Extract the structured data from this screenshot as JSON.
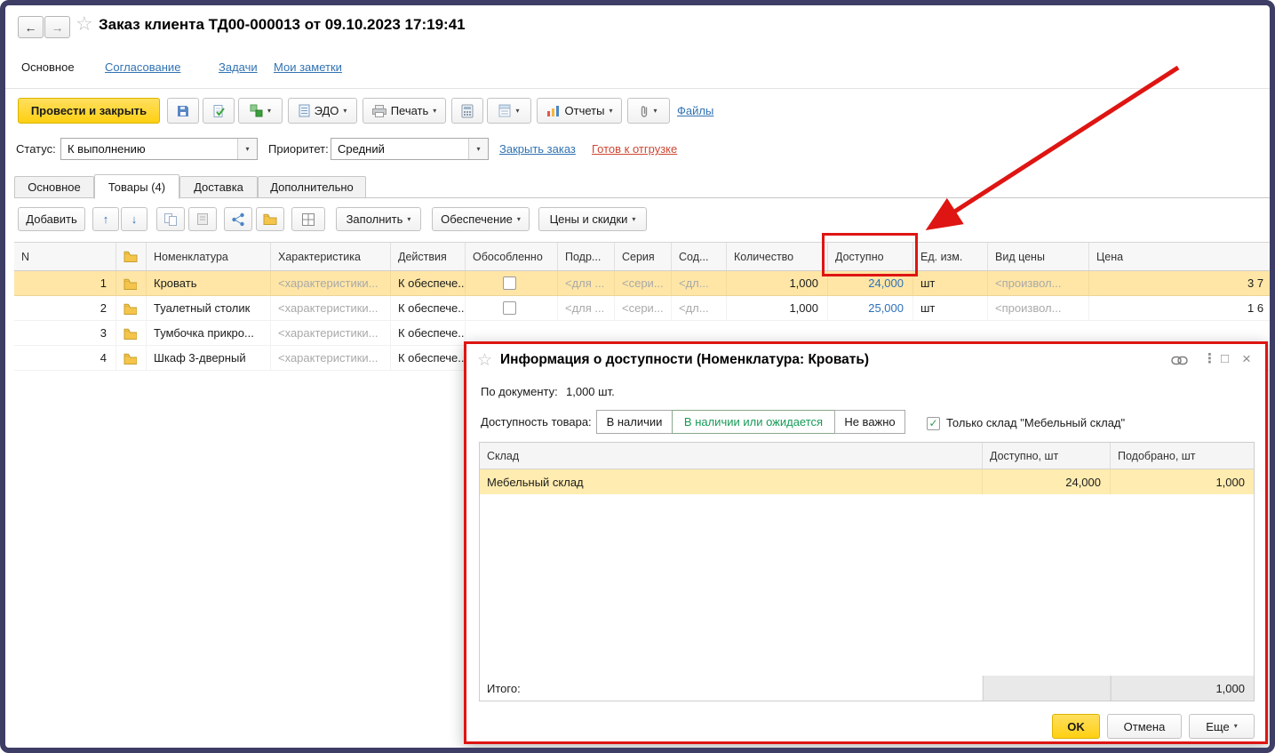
{
  "icons": {
    "back": "←",
    "forward": "→",
    "star": "☆",
    "dropdown": "▾",
    "combo": "▼",
    "up": "↑",
    "down": "↓",
    "check": "✓",
    "menu_dots": "⋮",
    "maximize": "□",
    "close": "×"
  },
  "header": {
    "title": "Заказ клиента ТД00-000013 от 09.10.2023 17:19:41"
  },
  "nav": {
    "items": [
      {
        "label": "Основное"
      },
      {
        "label": "Согласование"
      },
      {
        "label": "Задачи"
      },
      {
        "label": "Мои заметки"
      }
    ]
  },
  "toolbar": {
    "post_and_close": "Провести и закрыть",
    "edo": "ЭДО",
    "print": "Печать",
    "reports": "Отчеты",
    "files": "Файлы"
  },
  "status_row": {
    "status_label": "Статус:",
    "status_value": "К выполнению",
    "priority_label": "Приоритет:",
    "priority_value": "Средний",
    "close_order": "Закрыть заказ",
    "ready_to_ship": "Готов к отгрузке"
  },
  "doc_tabs": {
    "items": [
      {
        "label": "Основное"
      },
      {
        "label": "Товары (4)"
      },
      {
        "label": "Доставка"
      },
      {
        "label": "Дополнительно"
      }
    ]
  },
  "grid_toolbar": {
    "add": "Добавить",
    "fill": "Заполнить",
    "supply": "Обеспечение",
    "prices": "Цены и скидки"
  },
  "grid": {
    "headers": {
      "n": "N",
      "nomenclature": "Номенклатура",
      "characteristic": "Характеристика",
      "actions": "Действия",
      "separate": "Обособленно",
      "podr": "Подр...",
      "series": "Серия",
      "sod": "Сод...",
      "qty": "Количество",
      "available": "Доступно",
      "unit": "Ед. изм.",
      "price_type": "Вид цены",
      "price": "Цена"
    },
    "rows": [
      {
        "n": "1",
        "name": "Кровать",
        "characteristic": "<характеристики...",
        "action": "К обеспече...",
        "podr": "<для ...",
        "series": "<сери...",
        "sod": "<дл...",
        "qty": "1,000",
        "available": "24,000",
        "unit": "шт",
        "price_type": "<произвол...",
        "price": "3 7"
      },
      {
        "n": "2",
        "name": "Туалетный столик",
        "characteristic": "<характеристики...",
        "action": "К обеспече...",
        "podr": "<для ...",
        "series": "<сери...",
        "sod": "<дл...",
        "qty": "1,000",
        "available": "25,000",
        "unit": "шт",
        "price_type": "<произвол...",
        "price": "1 6"
      },
      {
        "n": "3",
        "name": "Тумбочка прикро...",
        "characteristic": "<характеристики...",
        "action": "К обеспече..."
      },
      {
        "n": "4",
        "name": "Шкаф 3-дверный",
        "characteristic": "<характеристики...",
        "action": "К обеспече..."
      }
    ]
  },
  "dialog": {
    "title": "Информация о доступности (Номенклатура: Кровать)",
    "doc_qty_label": "По документу:",
    "doc_qty_value": "1,000 шт.",
    "availability_label": "Доступность товара:",
    "options": [
      {
        "label": "В наличии"
      },
      {
        "label": "В наличии или ожидается"
      },
      {
        "label": "Не важно"
      }
    ],
    "warehouse_only_label": "Только склад \"Мебельный склад\"",
    "table": {
      "col_warehouse": "Склад",
      "col_available": "Доступно, шт",
      "col_picked": "Подобрано, шт",
      "rows": [
        {
          "warehouse": "Мебельный склад",
          "available": "24,000",
          "picked": "1,000"
        }
      ],
      "total_label": "Итого:",
      "total_picked": "1,000"
    },
    "ok": "OK",
    "cancel": "Отмена",
    "more": "Еще"
  },
  "colors": {
    "accent_yellow": "#ffd633",
    "link_blue": "#3173b2",
    "annotation_red": "#de1512",
    "selected_row": "#ffe6a6",
    "option_green": "#169a56",
    "red_link": "#cf4632"
  }
}
